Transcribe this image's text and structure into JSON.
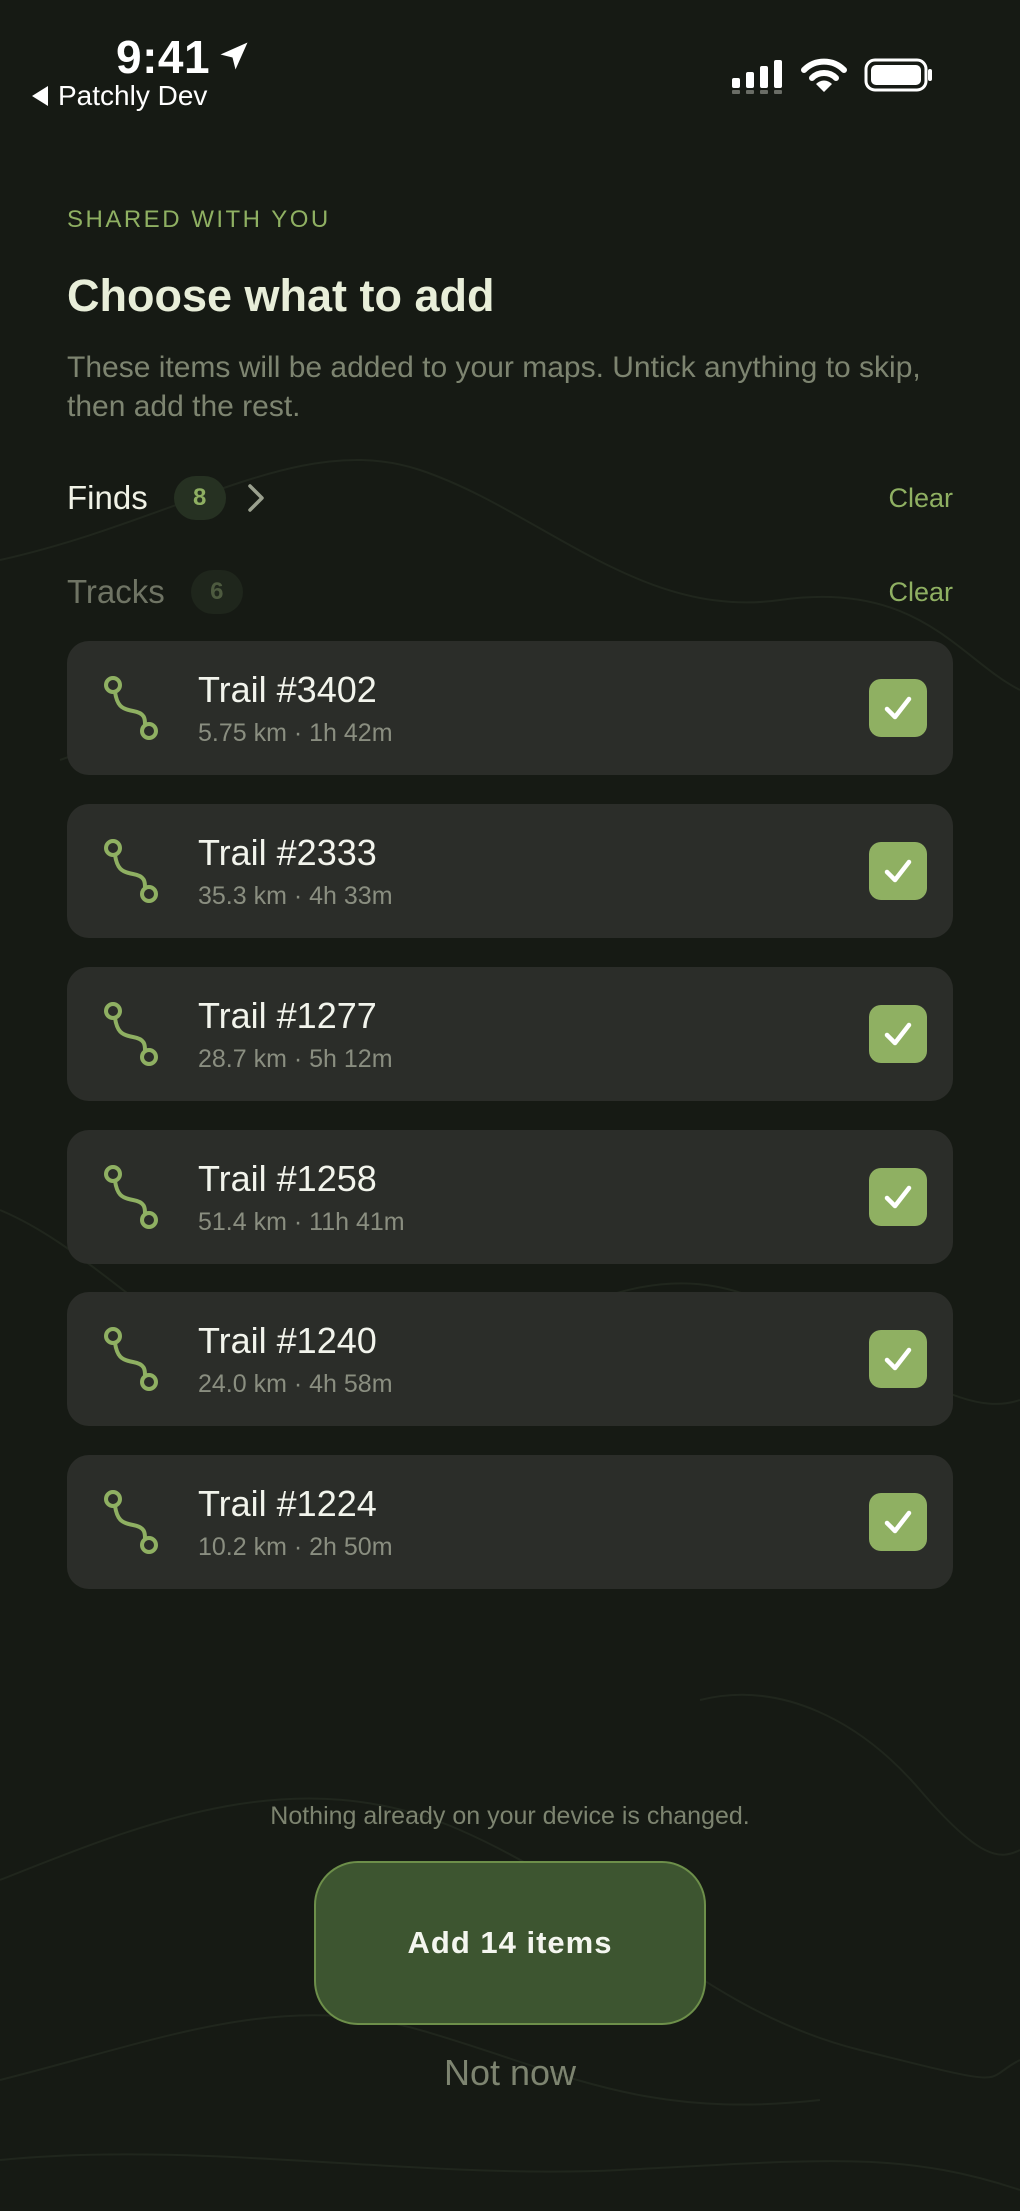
{
  "status_bar": {
    "time": "9:41",
    "back_app": "Patchly Dev"
  },
  "header": {
    "eyebrow": "SHARED WITH YOU",
    "title": "Choose what to add",
    "subtitle": "These items will be added to your maps. Untick anything to skip, then add the rest."
  },
  "sections": {
    "finds": {
      "label": "Finds",
      "count": "8",
      "clear_label": "Clear"
    },
    "tracks": {
      "label": "Tracks",
      "count": "6",
      "clear_label": "Clear"
    }
  },
  "tracks": [
    {
      "name": "Trail #3402",
      "meta": "5.75 km · 1h 42m",
      "checked": true
    },
    {
      "name": "Trail #2333",
      "meta": "35.3 km · 4h 33m",
      "checked": true
    },
    {
      "name": "Trail #1277",
      "meta": "28.7 km · 5h 12m",
      "checked": true
    },
    {
      "name": "Trail #1258",
      "meta": "51.4 km · 11h 41m",
      "checked": true
    },
    {
      "name": "Trail #1240",
      "meta": "24.0 km · 4h 58m",
      "checked": true
    },
    {
      "name": "Trail #1224",
      "meta": "10.2 km · 2h 50m",
      "checked": true
    }
  ],
  "footer": {
    "note": "Nothing already on your device is changed.",
    "primary_label": "Add 14 items",
    "secondary_label": "Not now"
  },
  "colors": {
    "background": "#161a14",
    "accent": "#8fb062",
    "card": "#2b2d29",
    "primary_button": "#3d5530"
  },
  "icons": {
    "location": "location-arrow-icon",
    "back": "back-triangle-icon",
    "signal": "cellular-signal-icon",
    "wifi": "wifi-icon",
    "battery": "battery-icon",
    "chevron": "chevron-right-icon",
    "route": "route-icon",
    "check": "checkmark-icon"
  }
}
